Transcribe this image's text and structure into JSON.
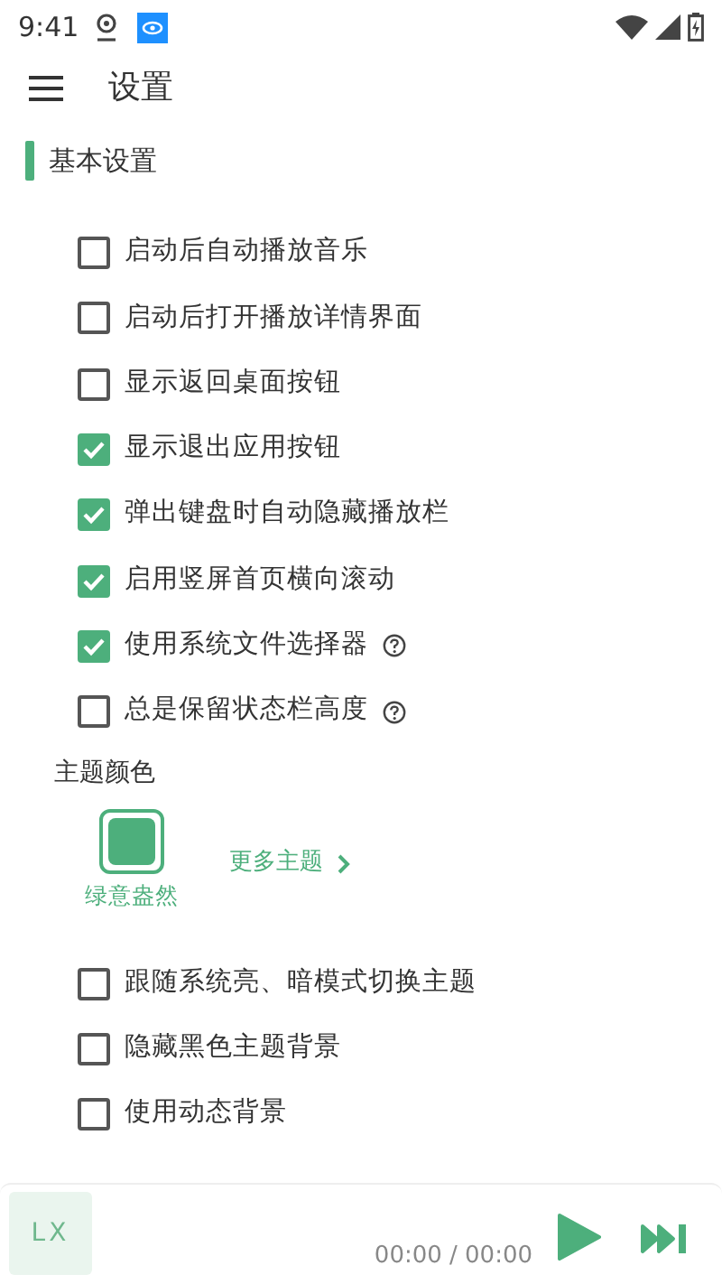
{
  "status_bar": {
    "time": "9:41"
  },
  "header": {
    "title": "设置"
  },
  "section": {
    "title": "基本设置"
  },
  "options": [
    {
      "label": "启动后自动播放音乐",
      "checked": false,
      "help": false
    },
    {
      "label": "启动后打开播放详情界面",
      "checked": false,
      "help": false
    },
    {
      "label": "显示返回桌面按钮",
      "checked": false,
      "help": false
    },
    {
      "label": "显示退出应用按钮",
      "checked": true,
      "help": false
    },
    {
      "label": "弹出键盘时自动隐藏播放栏",
      "checked": true,
      "help": false
    },
    {
      "label": "启用竖屏首页横向滚动",
      "checked": true,
      "help": false
    },
    {
      "label": "使用系统文件选择器",
      "checked": true,
      "help": true
    },
    {
      "label": "总是保留状态栏高度",
      "checked": false,
      "help": true
    }
  ],
  "theme": {
    "title": "主题颜色",
    "themes": [
      {
        "name": "绿意盎然",
        "color": "#4daf7c",
        "selected": true
      }
    ],
    "more": "更多主题"
  },
  "theme_options": [
    {
      "label": "跟随系统亮、暗模式切换主题",
      "checked": false
    },
    {
      "label": "隐藏黑色主题背景",
      "checked": false
    },
    {
      "label": "使用动态背景",
      "checked": false
    }
  ],
  "player": {
    "cover": "LX",
    "time": "00:00 / 00:00"
  }
}
